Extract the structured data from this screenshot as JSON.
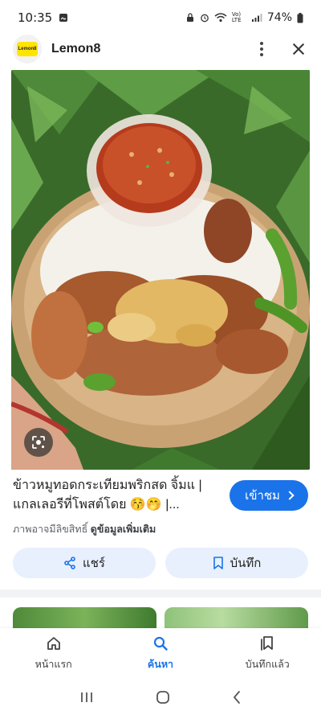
{
  "status_bar": {
    "time": "10:35",
    "battery": "74%",
    "network": "Vo) LTE"
  },
  "header": {
    "logo_text": "Lemon8",
    "app_name": "Lemon8",
    "icons": [
      "more-vert-icon",
      "close-icon"
    ]
  },
  "hero": {
    "alt": "",
    "lens_icon": "google-lens-icon"
  },
  "result": {
    "title": "ข้าวหมูทอดกระเทียมพริกสด จิ้มแ | แกลเลอรีที่โพสต์โดย 😚🤭 |...",
    "visit_label": "เข้าชม",
    "copyright": "ภาพอาจมีลิขสิทธิ์",
    "more_info": "ดูข้อมูลเพิ่มเติม"
  },
  "actions": {
    "share_label": "แชร์",
    "save_label": "บันทึก"
  },
  "bottom_nav": {
    "items": [
      {
        "label": "หน้าแรก",
        "icon": "home-icon"
      },
      {
        "label": "ค้นหา",
        "icon": "search-icon"
      },
      {
        "label": "บันทึกแล้ว",
        "icon": "saved-icon"
      }
    ],
    "active_index": 1
  },
  "colors": {
    "accent": "#1a73e8",
    "action_bg": "#e8f0fe",
    "logo_yellow": "#ffe400"
  }
}
